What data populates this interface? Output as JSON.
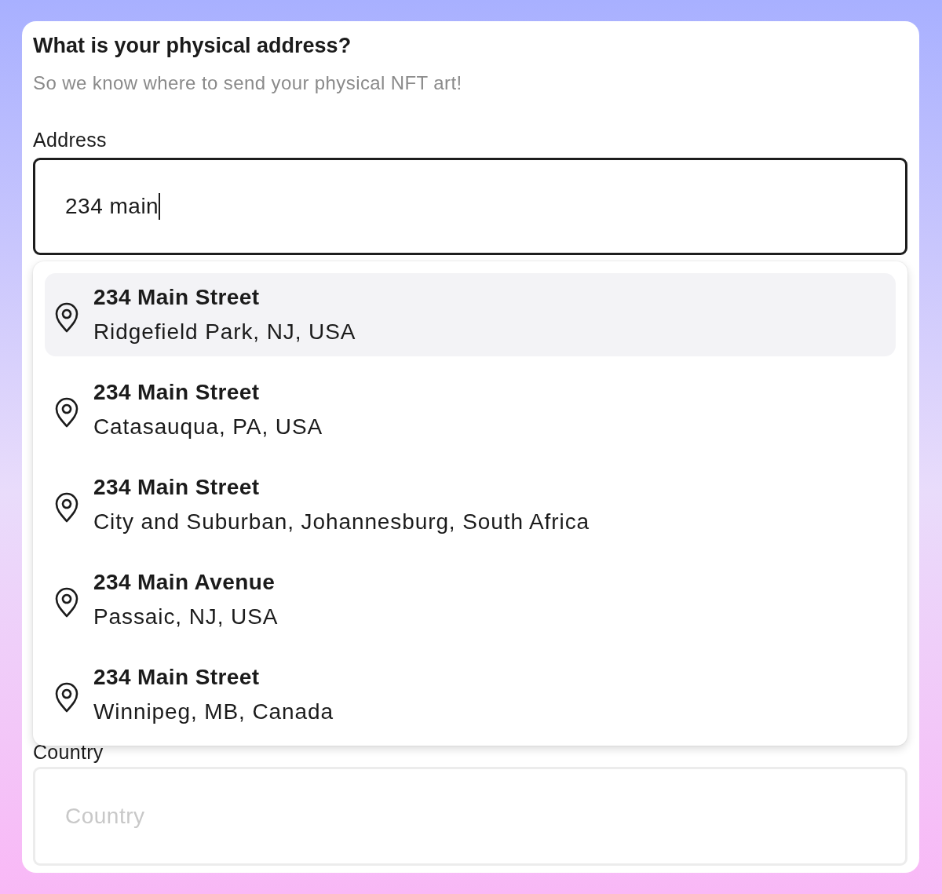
{
  "title": "What is your physical address?",
  "subtitle": "So we know where to send your physical NFT art!",
  "address": {
    "label": "Address",
    "value": "234 main"
  },
  "suggestions": [
    {
      "street": "234 Main Street",
      "locality": "Ridgefield Park, NJ, USA",
      "selected": true
    },
    {
      "street": "234 Main Street",
      "locality": "Catasauqua, PA, USA",
      "selected": false
    },
    {
      "street": "234 Main Street",
      "locality": "City and Suburban, Johannesburg, South Africa",
      "selected": false
    },
    {
      "street": "234 Main Avenue",
      "locality": "Passaic, NJ, USA",
      "selected": false
    },
    {
      "street": "234 Main Street",
      "locality": "Winnipeg, MB, Canada",
      "selected": false
    }
  ],
  "country": {
    "label": "Country",
    "placeholder": "Country"
  }
}
